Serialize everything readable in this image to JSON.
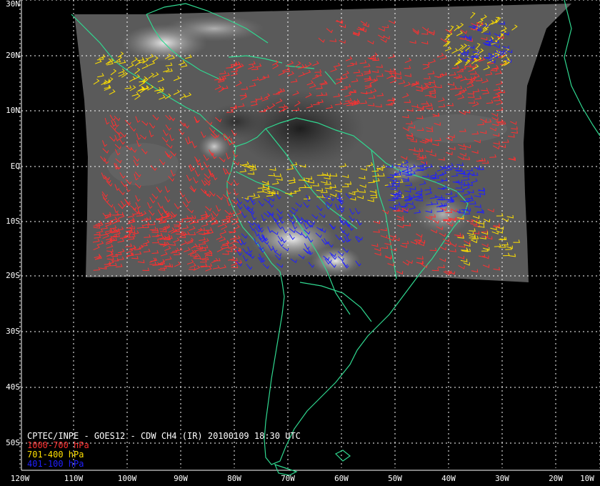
{
  "map": {
    "title": "CPTEC/INPE - GOES12 - CDW CH4 (IR) 20100109 18:30 UTC",
    "lat_labels": [
      "30N",
      "20N",
      "10N",
      "EQ",
      "10S",
      "20S",
      "30S",
      "40S",
      "50S"
    ],
    "lon_labels": [
      "120W",
      "110W",
      "100W",
      "90W",
      "80W",
      "70W",
      "60W",
      "50W",
      "40W",
      "30W",
      "20W",
      "10W"
    ],
    "legend": [
      {
        "label": "1000-700 hPa",
        "color": "#ff3030"
      },
      {
        "label": "701-400 hPa",
        "color": "#ffe000"
      },
      {
        "label": "401-100 hPa",
        "color": "#2020ff"
      }
    ],
    "coastline_color": "#30d890",
    "grid": "dotted white"
  }
}
